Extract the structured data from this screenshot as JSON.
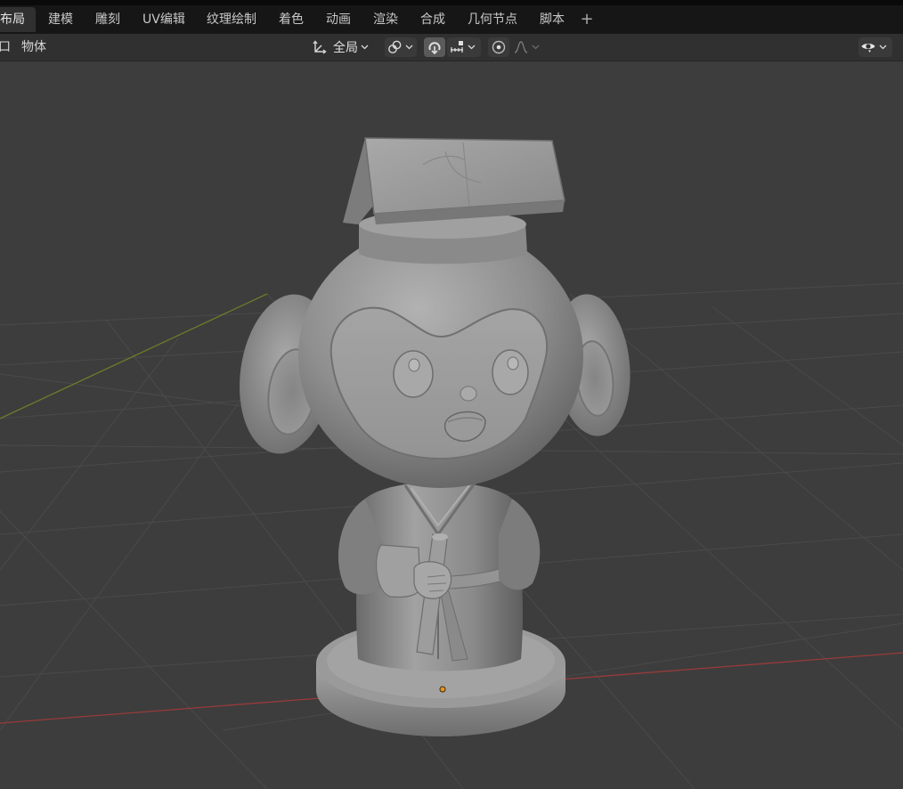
{
  "workspace_tabs": [
    {
      "label": "布局",
      "active": true
    },
    {
      "label": "建模"
    },
    {
      "label": "雕刻"
    },
    {
      "label": "UV编辑"
    },
    {
      "label": "纹理绘制"
    },
    {
      "label": "着色"
    },
    {
      "label": "动画"
    },
    {
      "label": "渲染"
    },
    {
      "label": "合成"
    },
    {
      "label": "几何节点"
    },
    {
      "label": "脚本"
    }
  ],
  "add_tab": "+",
  "header": {
    "menu_window_partial": "口",
    "menu_object": "物体",
    "transform_orientation": "全局",
    "icons": {
      "orientation": "transform-orientation-icon",
      "pivot": "pivot-point-icon",
      "snap": "snap-magnet-icon",
      "snap_target": "snap-increment-icon",
      "proportional": "proportional-edit-icon",
      "falloff": "falloff-curve-icon",
      "visibility": "eye-visibility-icon"
    }
  },
  "colors": {
    "tabbar_bg": "#161616",
    "header_bg": "#303030",
    "viewport_bg": "#3d3d3d",
    "grid_line": "#4a4a4a",
    "axis_x": "#9a3a3a",
    "axis_y": "#6e7a2a",
    "origin_dot": "#e89520",
    "model_grey": "#8e8e8e"
  }
}
